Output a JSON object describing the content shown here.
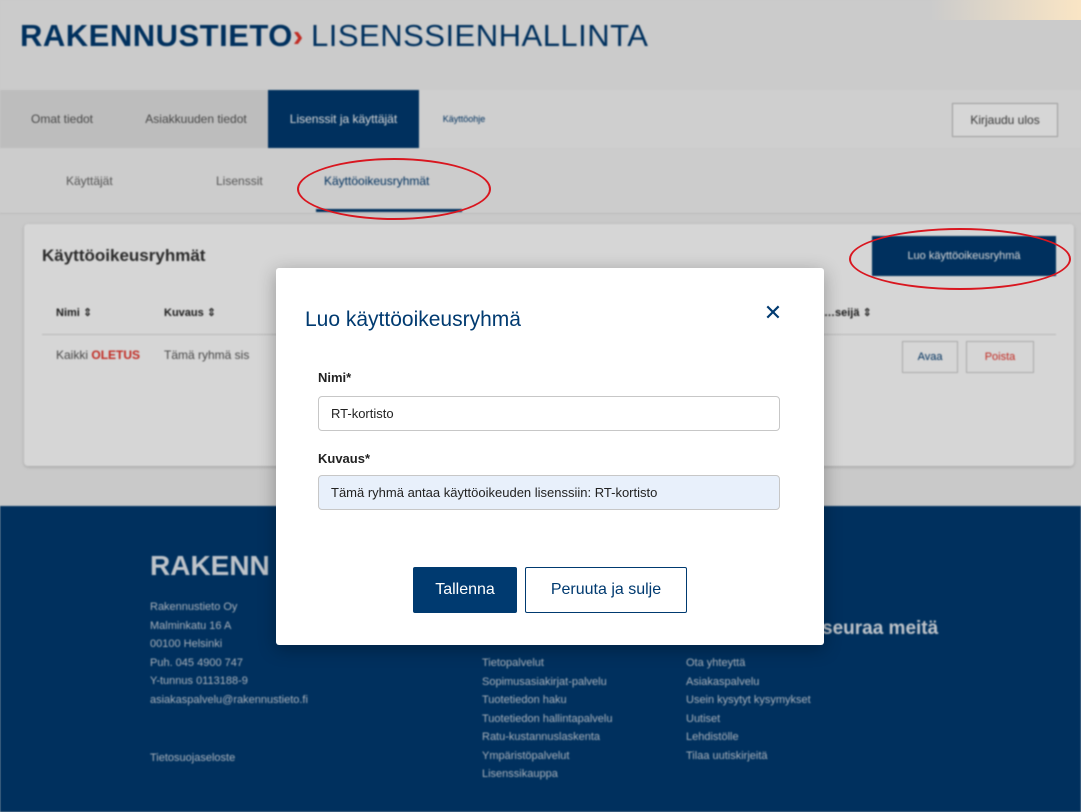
{
  "header": {
    "logo_text": "RAKENNUSTIETO",
    "logo_chevron": "›",
    "app_title": "LISENSSIENHALLINTA"
  },
  "topnav": {
    "items": [
      {
        "label": "Omat tiedot"
      },
      {
        "label": "Asiakkuuden tiedot"
      },
      {
        "label": "Lisenssit ja käyttäjät",
        "active": true
      },
      {
        "label": "Käyttöohje"
      }
    ],
    "logout_label": "Kirjaudu ulos"
  },
  "subnav": {
    "items": [
      {
        "label": "Käyttäjät"
      },
      {
        "label": "Lisenssit"
      },
      {
        "label": "Käyttöoikeusryhmät",
        "active": true
      }
    ]
  },
  "card": {
    "title": "Käyttöoikeusryhmät",
    "create_button_label": "Luo käyttöoikeusryhmä",
    "columns": [
      "Nimi ⇕",
      "Kuvaus ⇕",
      "…seijä ⇕"
    ],
    "rows": [
      {
        "name": "Kaikki",
        "badge": "OLETUS",
        "description": "Tämä ryhmä sis",
        "open_label": "Avaa",
        "delete_label": "Poista"
      }
    ]
  },
  "footer": {
    "logo_text": "RAKENN",
    "contact": [
      "Rakennustieto Oy",
      "Malminkatu 16 A",
      "00100 Helsinki",
      "Puh. 045 4900 747",
      "Y-tunnus 0113188-9",
      "asiakaspalvelu@rakennustieto.fi"
    ],
    "privacy": "Tietosuojaseloste",
    "follow": "seuraa meitä",
    "services": [
      "Tietopalvelut",
      "Sopimusasiakirjat-palvelu",
      "Tuotetiedon haku",
      "Tuotetiedon hallintapalvelu",
      "Ratu-kustannuslaskenta",
      "Ympäristöpalvelut",
      "Lisenssikauppa"
    ],
    "support": [
      "Ota yhteyttä",
      "Asiakaspalvelu",
      "Usein kysytyt kysymykset",
      "Uutiset",
      "Lehdistölle",
      "Tilaa uutiskirjeitä"
    ]
  },
  "modal": {
    "title": "Luo käyttöoikeusryhmä",
    "close_glyph": "✕",
    "name_label": "Nimi*",
    "name_value": "RT-kortisto",
    "description_label": "Kuvaus*",
    "description_value": "Tämä ryhmä antaa käyttöoikeuden lisenssiin: RT-kortisto",
    "save_label": "Tallenna",
    "cancel_label": "Peruuta ja sulje"
  },
  "colors": {
    "brand_blue": "#003a70",
    "brand_red": "#e6332a",
    "annotation_red": "#d9161f"
  }
}
